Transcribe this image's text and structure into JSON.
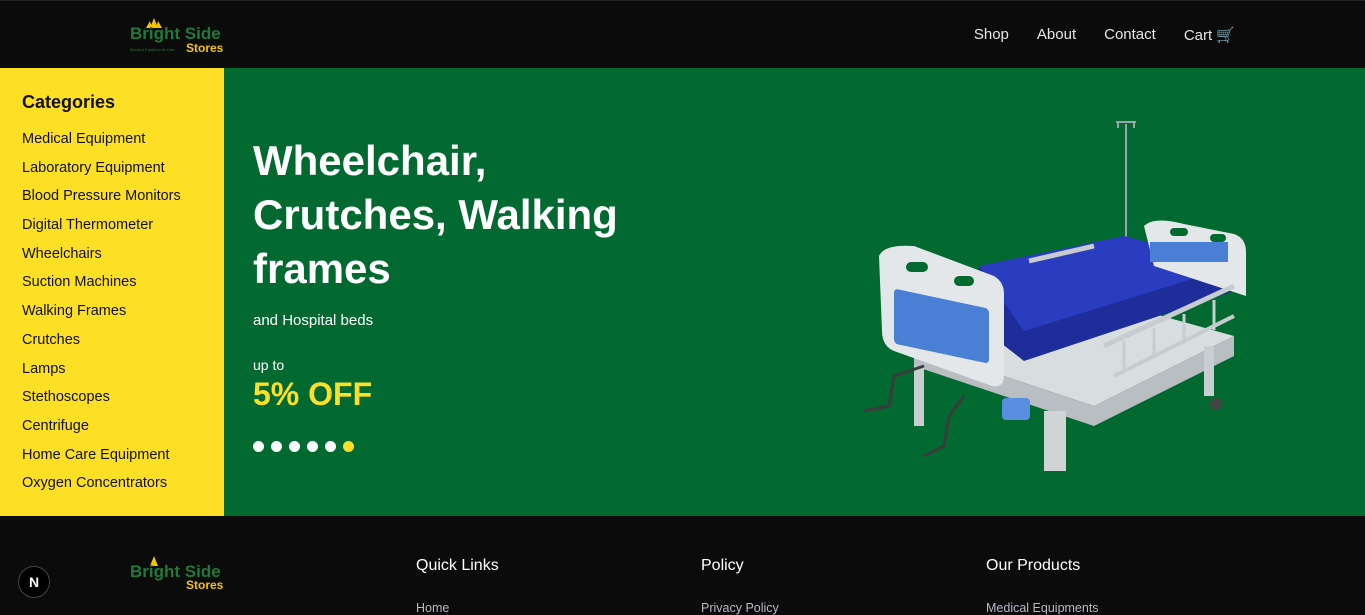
{
  "brand": {
    "line1": "Bright Side",
    "line2": "Stores",
    "tagline": "Medical Equipments Hub"
  },
  "nav": [
    {
      "label": "Shop"
    },
    {
      "label": "About"
    },
    {
      "label": "Contact"
    },
    {
      "label": "Cart 🛒"
    }
  ],
  "sidebar": {
    "title": "Categories",
    "items": [
      "Medical Equipment",
      "Laboratory Equipment",
      "Blood Pressure Monitors",
      "Digital Thermometer",
      "Wheelchairs",
      "Suction Machines",
      "Walking Frames",
      "Crutches",
      "Lamps",
      "Stethoscopes",
      "Centrifuge",
      "Home Care Equipment",
      "Oxygen Concentrators"
    ]
  },
  "hero": {
    "title": "Wheelchair, Crutches, Walking frames",
    "subtitle": "and Hospital beds",
    "upto": "up to",
    "discount": "5% OFF",
    "slides_total": 6,
    "active_slide": 6
  },
  "footer": {
    "quick_links": {
      "title": "Quick Links",
      "first": "Home"
    },
    "policy": {
      "title": "Policy",
      "first": "Privacy Policy"
    },
    "products": {
      "title": "Our Products",
      "first": "Medical Equipments"
    }
  },
  "dev_badge": "N",
  "colors": {
    "accent_yellow": "#fde025",
    "hero_green": "#026a30",
    "dark": "#0b0b0b"
  }
}
